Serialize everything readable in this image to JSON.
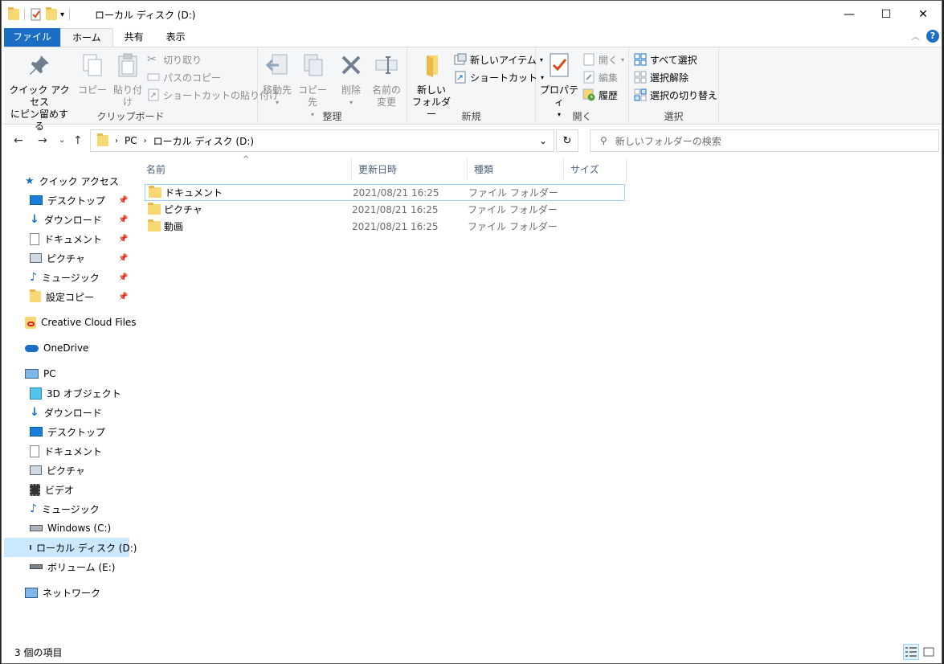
{
  "window": {
    "title": "ローカル ディスク (D:)",
    "controls": {
      "minimize": "—",
      "maximize": "☐",
      "close": "✕"
    }
  },
  "tabs": [
    {
      "label": "ファイル"
    },
    {
      "label": "ホーム"
    },
    {
      "label": "共有"
    },
    {
      "label": "表示"
    }
  ],
  "ribbon": {
    "clipboard": {
      "label": "クリップボード",
      "pin": "クイック アクセス\nにピン留めする",
      "pin_line1": "クイック アクセス",
      "pin_line2": "にピン留めする",
      "copy": "コピー",
      "paste": "貼り付け",
      "cut": "切り取り",
      "copy_path": "パスのコピー",
      "paste_shortcut": "ショートカットの貼り付け"
    },
    "organize": {
      "label": "整理",
      "move_to": "移動先",
      "copy_to": "コピー先",
      "delete": "削除",
      "rename_line1": "名前の",
      "rename_line2": "変更"
    },
    "new": {
      "label": "新規",
      "new_folder_line1": "新しい",
      "new_folder_line2": "フォルダー",
      "new_item": "新しいアイテム",
      "shortcut": "ショートカット"
    },
    "open": {
      "label": "開く",
      "properties": "プロパティ",
      "open": "開く",
      "edit": "編集",
      "history": "履歴"
    },
    "select": {
      "label": "選択",
      "select_all": "すべて選択",
      "select_none": "選択解除",
      "invert": "選択の切り替え"
    }
  },
  "address": {
    "path": [
      "PC",
      "ローカル ディスク (D:)"
    ],
    "search_placeholder": "新しいフォルダーの検索"
  },
  "nav": {
    "quick_access": "クイック アクセス",
    "quick_items": [
      "デスクトップ",
      "ダウンロード",
      "ドキュメント",
      "ピクチャ",
      "ミュージック",
      "設定コピー"
    ],
    "creative_cloud": "Creative Cloud Files",
    "onedrive": "OneDrive",
    "pc": "PC",
    "pc_items": [
      "3D オブジェクト",
      "ダウンロード",
      "デスクトップ",
      "ドキュメント",
      "ピクチャ",
      "ビデオ",
      "ミュージック",
      "Windows (C:)",
      "ローカル ディスク (D:)",
      "ボリューム (E:)"
    ],
    "network": "ネットワーク"
  },
  "columns": {
    "name": "名前",
    "modified": "更新日時",
    "type": "種類",
    "size": "サイズ"
  },
  "files": [
    {
      "name": "ドキュメント",
      "modified": "2021/08/21 16:25",
      "type": "ファイル フォルダー"
    },
    {
      "name": "ピクチャ",
      "modified": "2021/08/21 16:25",
      "type": "ファイル フォルダー"
    },
    {
      "name": "動画",
      "modified": "2021/08/21 16:25",
      "type": "ファイル フォルダー"
    }
  ],
  "status": {
    "count": "3 個の項目"
  },
  "colors": {
    "accent": "#1a6fc4",
    "selection": "#cce8ff",
    "folder": "#f8d775"
  }
}
